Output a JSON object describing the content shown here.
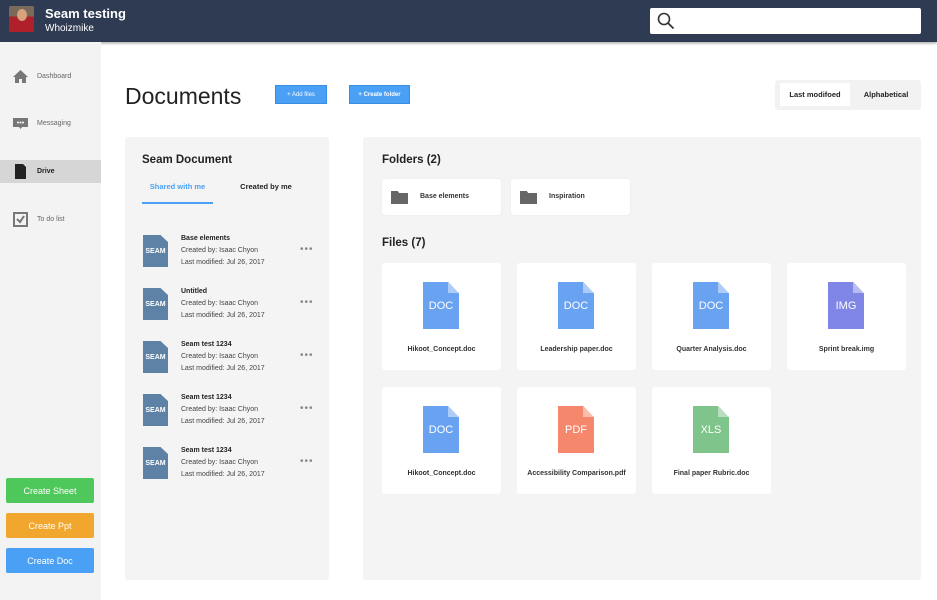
{
  "header": {
    "title": "Seam testing",
    "subtitle": "Whoizmike"
  },
  "sidebar": {
    "items": [
      {
        "label": "Dashboard"
      },
      {
        "label": "Messaging"
      },
      {
        "label": "Drive"
      },
      {
        "label": "To do list"
      }
    ],
    "buttons": {
      "sheet": "Create Sheet",
      "ppt": "Create Ppt",
      "doc": "Create Doc"
    }
  },
  "page": {
    "title": "Documents",
    "add_files": "+ Add files",
    "create_folder": "+ Create folder",
    "sort": {
      "options": [
        "Last modifoed",
        "Alphabetical"
      ],
      "selected": "Last modifoed"
    }
  },
  "left": {
    "title": "Seam Document",
    "tabs": [
      "Shared with me",
      "Created by me"
    ],
    "active_tab": "Shared with me",
    "items": [
      {
        "icon": "SEAM",
        "name": "Base elements",
        "by": "Created by: Isaac Chyon",
        "mod": "Last modified: Jul 26, 2017"
      },
      {
        "icon": "SEAM",
        "name": "Untitled",
        "by": "Created by: Isaac Chyon",
        "mod": "Last modified: Jul 26, 2017"
      },
      {
        "icon": "SEAM",
        "name": "Seam test 1234",
        "by": "Created by: Isaac Chyon",
        "mod": "Last modified: Jul 26, 2017"
      },
      {
        "icon": "SEAM",
        "name": "Seam test 1234",
        "by": "Created by: Isaac Chyon",
        "mod": "Last modified: Jul 26, 2017"
      },
      {
        "icon": "SEAM",
        "name": "Seam test 1234",
        "by": "Created by: Isaac Chyon",
        "mod": "Last modified: Jul 26, 2017"
      }
    ]
  },
  "right": {
    "folders_title": "Folders (2)",
    "folders": [
      "Base elements",
      "Inspiration"
    ],
    "files_title": "Files (7)",
    "files": [
      {
        "type": "DOC",
        "name": "Hikoot_Concept.doc",
        "color": "#6aa2f2"
      },
      {
        "type": "DOC",
        "name": "Leadership paper.doc",
        "color": "#6aa2f2"
      },
      {
        "type": "DOC",
        "name": "Quarter Analysis.doc",
        "color": "#6aa2f2"
      },
      {
        "type": "IMG",
        "name": "Sprint break.img",
        "color": "#7f86e6"
      },
      {
        "type": "DOC",
        "name": "Hikoot_Concept.doc",
        "color": "#6aa2f2"
      },
      {
        "type": "PDF",
        "name": "Accessibility Comparison.pdf",
        "color": "#f5876c"
      },
      {
        "type": "XLS",
        "name": "Final paper Rubric.doc",
        "color": "#7fc48a"
      }
    ]
  }
}
